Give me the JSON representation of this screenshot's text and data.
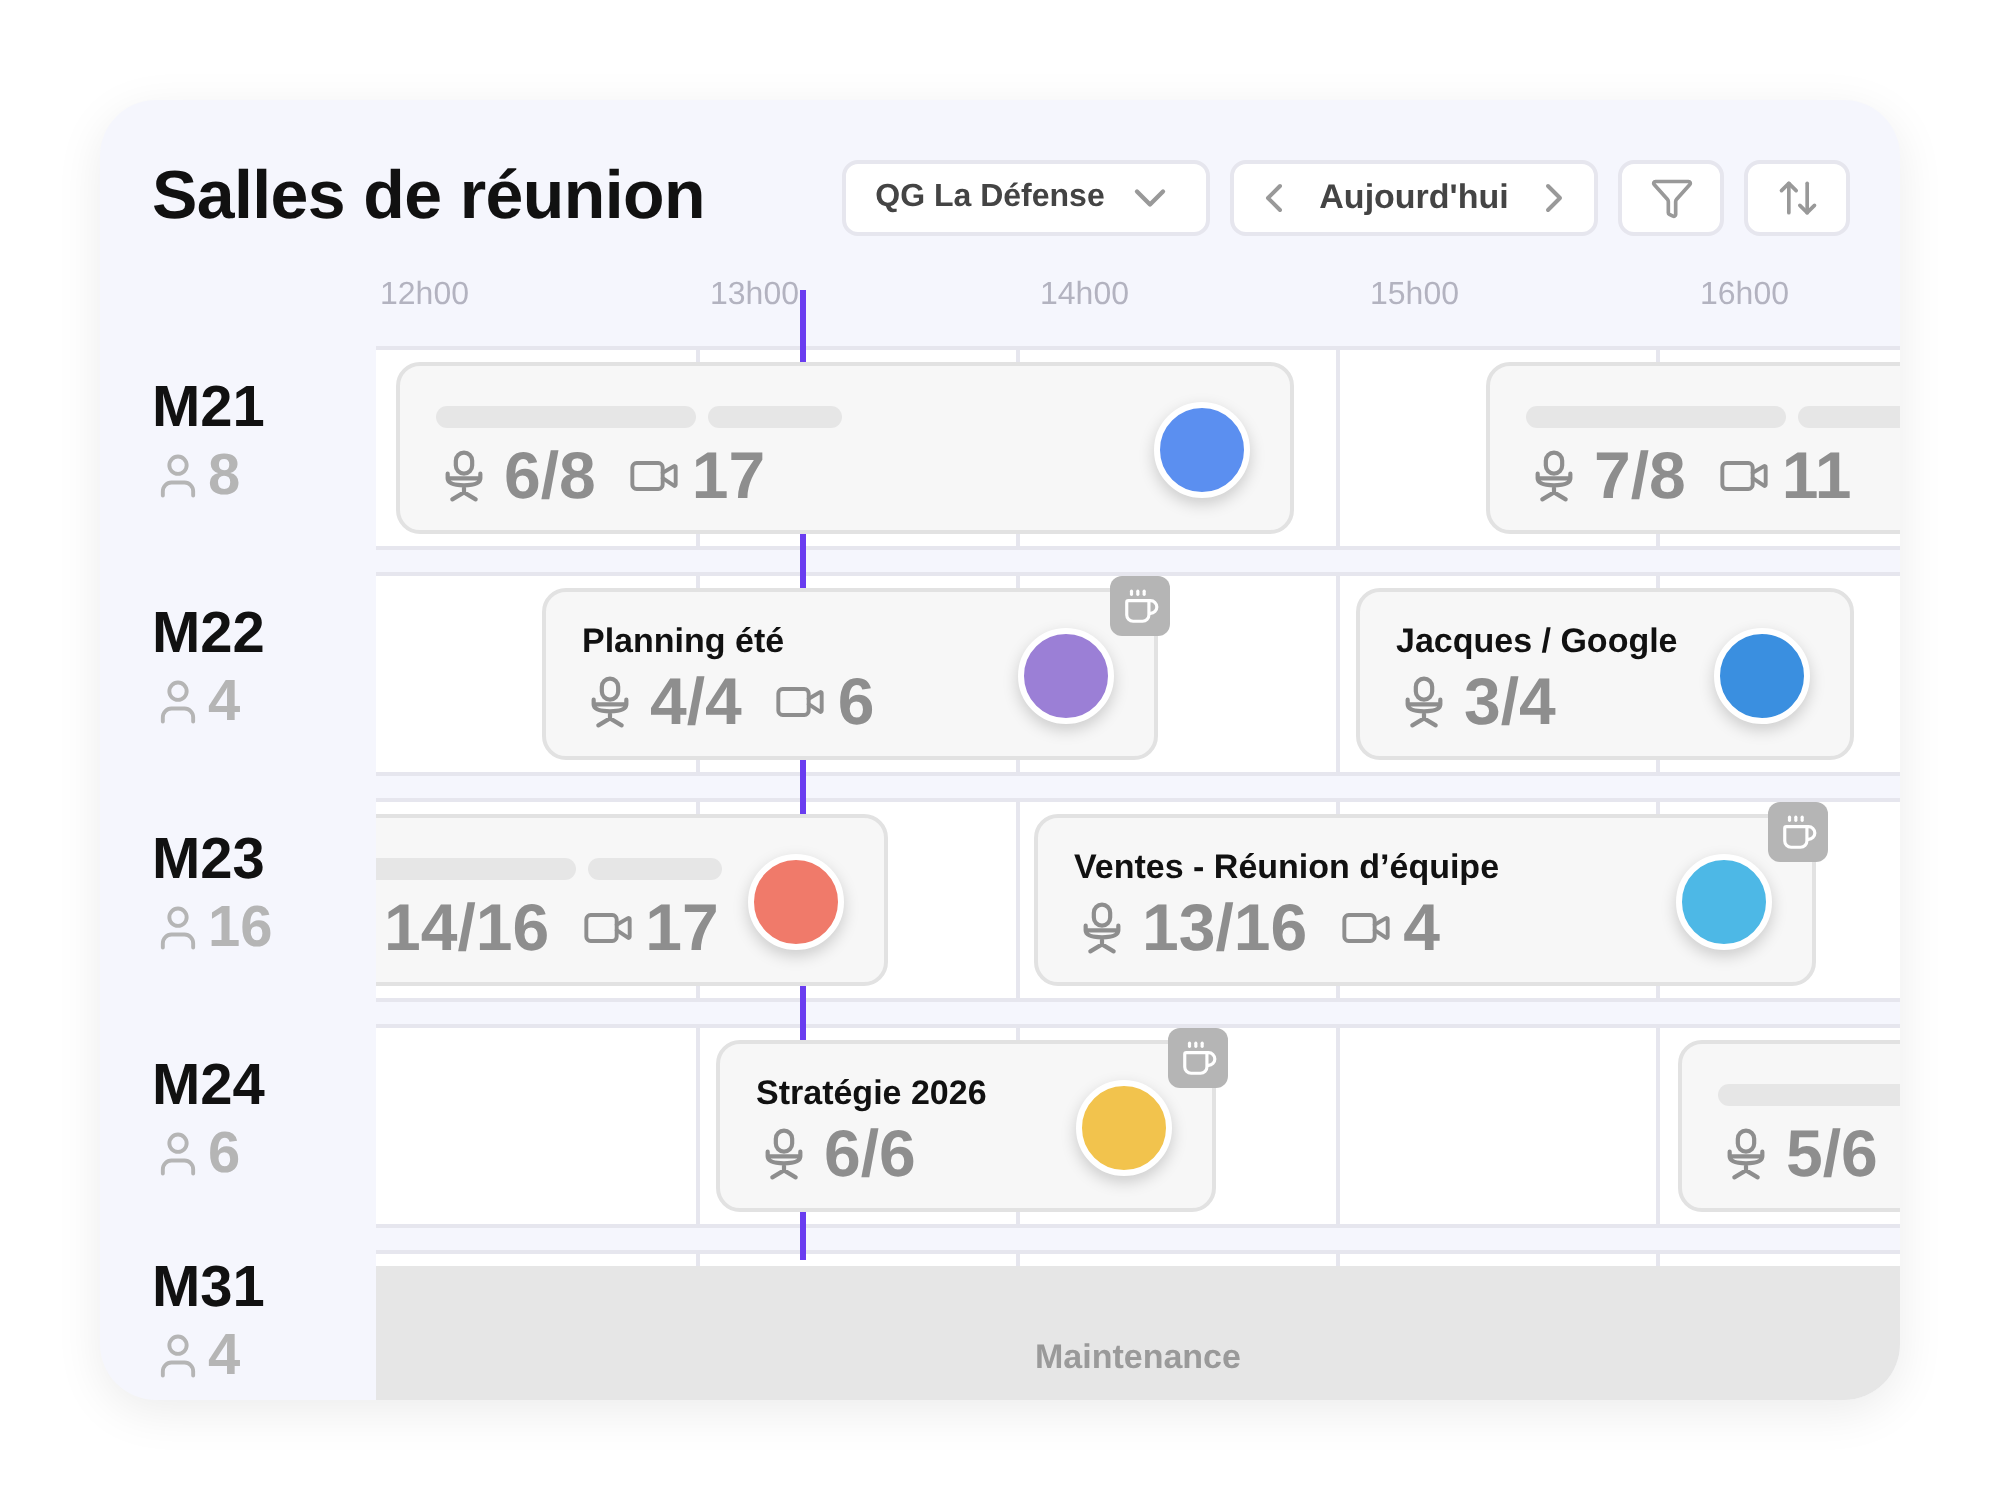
{
  "title": "Salles de réunion",
  "location": {
    "value": "QG La Défense"
  },
  "date_nav": {
    "label": "Aujourd'hui"
  },
  "hours": [
    "12h00",
    "13h00",
    "14h00",
    "15h00",
    "16h00"
  ],
  "rooms": [
    {
      "name": "M21",
      "capacity": "8",
      "events": [
        {
          "kind": "placeholder",
          "seats": "6/8",
          "video": "17",
          "catering": false
        },
        {
          "kind": "placeholder",
          "seats": "7/8",
          "video": "11",
          "catering": false
        }
      ]
    },
    {
      "name": "M22",
      "capacity": "4",
      "events": [
        {
          "kind": "titled",
          "title": "Planning été",
          "seats": "4/4",
          "video": "6",
          "catering": true
        },
        {
          "kind": "titled",
          "title": "Jacques / Google",
          "seats": "3/4",
          "catering": false
        }
      ]
    },
    {
      "name": "M23",
      "capacity": "16",
      "events": [
        {
          "kind": "placeholder",
          "seats": "14/16",
          "video": "17",
          "catering": false
        },
        {
          "kind": "titled",
          "title": "Ventes - Réunion d’équipe",
          "seats": "13/16",
          "video": "4",
          "catering": true
        }
      ]
    },
    {
      "name": "M24",
      "capacity": "6",
      "events": [
        {
          "kind": "titled",
          "title": "Stratégie 2026",
          "seats": "6/6",
          "catering": true
        },
        {
          "kind": "placeholder",
          "seats": "5/6",
          "catering": false
        }
      ]
    },
    {
      "name": "M31",
      "capacity": "4",
      "events": [
        {
          "kind": "blocked",
          "label": "Maintenance"
        }
      ]
    }
  ]
}
